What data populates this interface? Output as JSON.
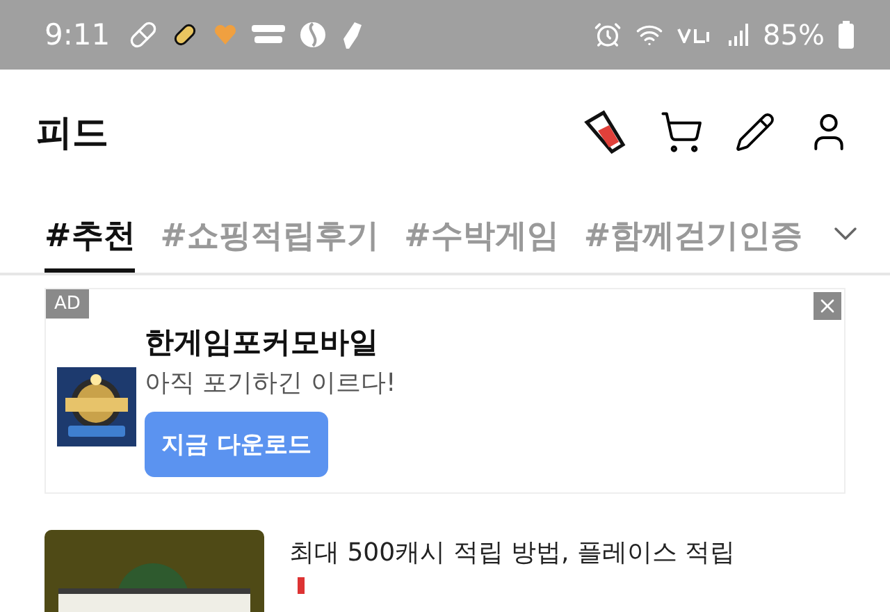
{
  "status_bar": {
    "time": "9:11",
    "battery": "85%"
  },
  "header": {
    "title": "피드"
  },
  "tabs": [
    {
      "label": "#추천",
      "selected": true
    },
    {
      "label": "#쇼핑적립후기",
      "selected": false
    },
    {
      "label": "#수박게임",
      "selected": false
    },
    {
      "label": "#함께걷기인증",
      "selected": false
    }
  ],
  "ad": {
    "badge": "AD",
    "title": "한게임포커모바일",
    "subtitle": "아직 포기하긴 이르다!",
    "button": "지금 다운로드"
  },
  "feed": [
    {
      "title": "최대 500캐시 적립 방법, 플레이스 적립"
    }
  ]
}
